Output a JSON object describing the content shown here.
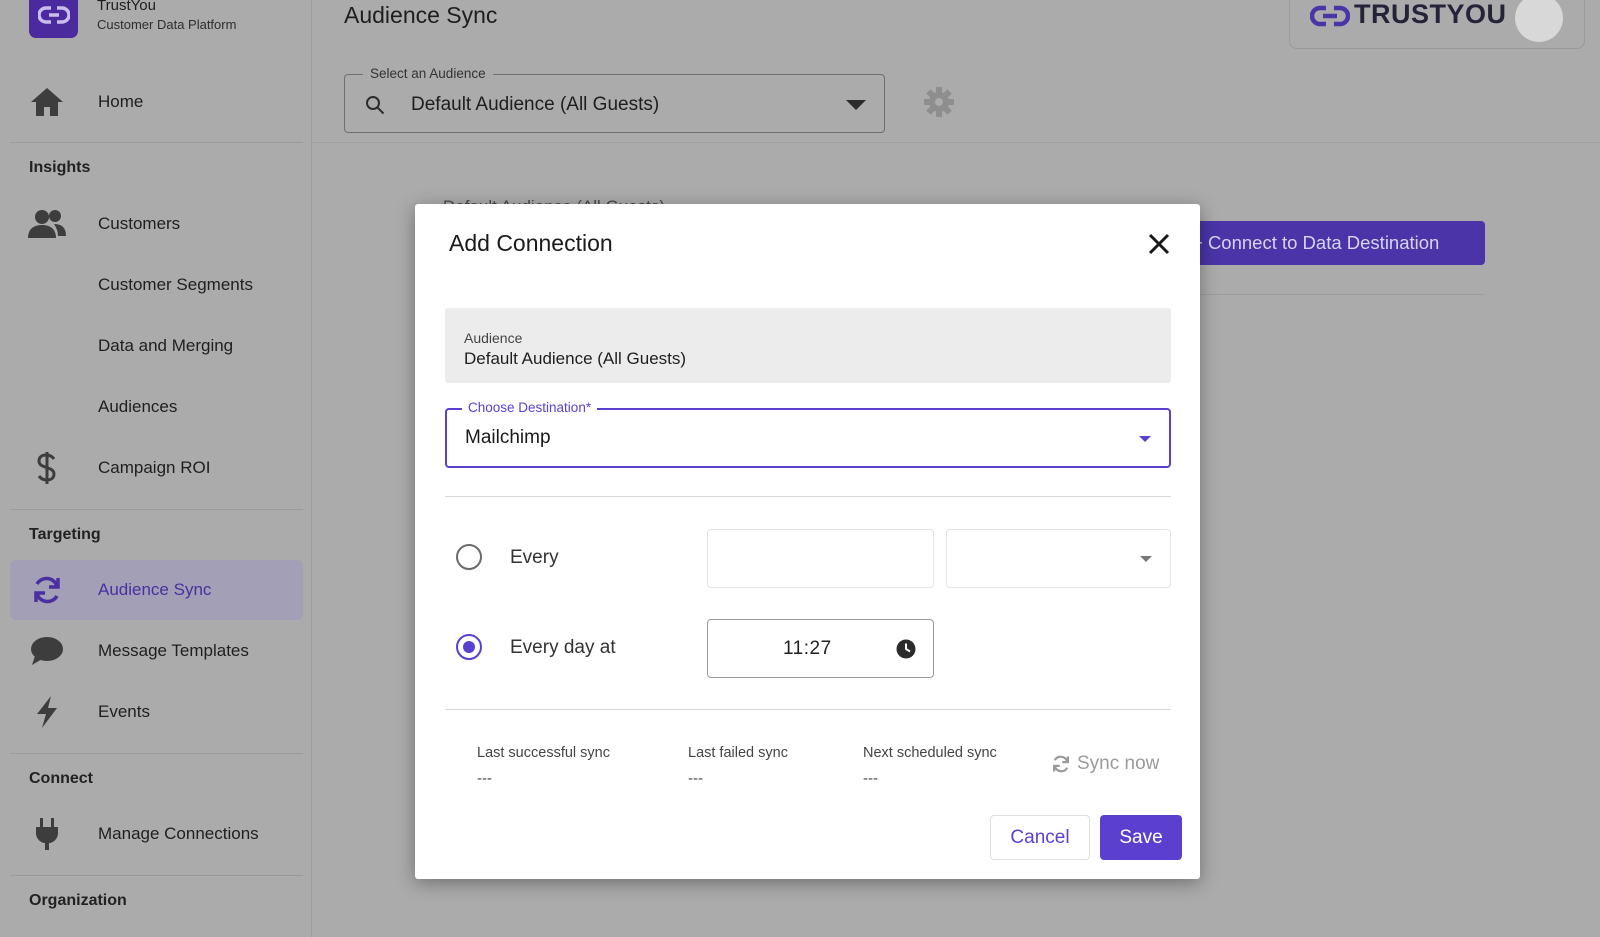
{
  "brand": {
    "name": "TrustYou",
    "subtitle": "Customer Data Platform"
  },
  "sidebar": {
    "home": {
      "label": "Home",
      "icon": "home-icon"
    },
    "sections": {
      "insights": "Insights",
      "targeting": "Targeting",
      "connect": "Connect",
      "organization": "Organization"
    },
    "items": [
      {
        "label": "Customers",
        "icon": "people-icon"
      },
      {
        "label": "Customer Segments"
      },
      {
        "label": "Data and Merging"
      },
      {
        "label": "Audiences"
      },
      {
        "label": "Campaign ROI",
        "icon": "dollar-icon"
      },
      {
        "label": "Audience Sync",
        "icon": "sync-icon",
        "active": true
      },
      {
        "label": "Message Templates",
        "icon": "chat-bubble-icon"
      },
      {
        "label": "Events",
        "icon": "lightning-icon"
      },
      {
        "label": "Manage Connections",
        "icon": "plug-icon"
      }
    ]
  },
  "header": {
    "title": "Audience Sync",
    "audience_select": {
      "legend": "Select an Audience",
      "value": "Default Audience (All Guests)"
    },
    "logo_wordmark": "TRUSTYOU"
  },
  "background": {
    "heading": "Default Audience (All Guests)",
    "connect_button": "+ Connect to Data Destination"
  },
  "modal": {
    "title": "Add Connection",
    "audience_field": {
      "label": "Audience",
      "value": "Default Audience (All Guests)"
    },
    "destination": {
      "legend": "Choose Destination*",
      "value": "Mailchimp"
    },
    "schedule": {
      "every_label": "Every",
      "every_value": "",
      "every_unit": "",
      "every_day_label": "Every day at",
      "time": "11:27",
      "selected": "every_day"
    },
    "stats": [
      {
        "label": "Last successful sync",
        "value": "---"
      },
      {
        "label": "Last failed sync",
        "value": "---"
      },
      {
        "label": "Next scheduled sync",
        "value": "---"
      }
    ],
    "sync_now": "Sync now",
    "cancel": "Cancel",
    "save": "Save"
  },
  "colors": {
    "accent": "#5b40d0",
    "brand_dark": "#4a2a9c",
    "overlay_bg": "#ababab"
  }
}
